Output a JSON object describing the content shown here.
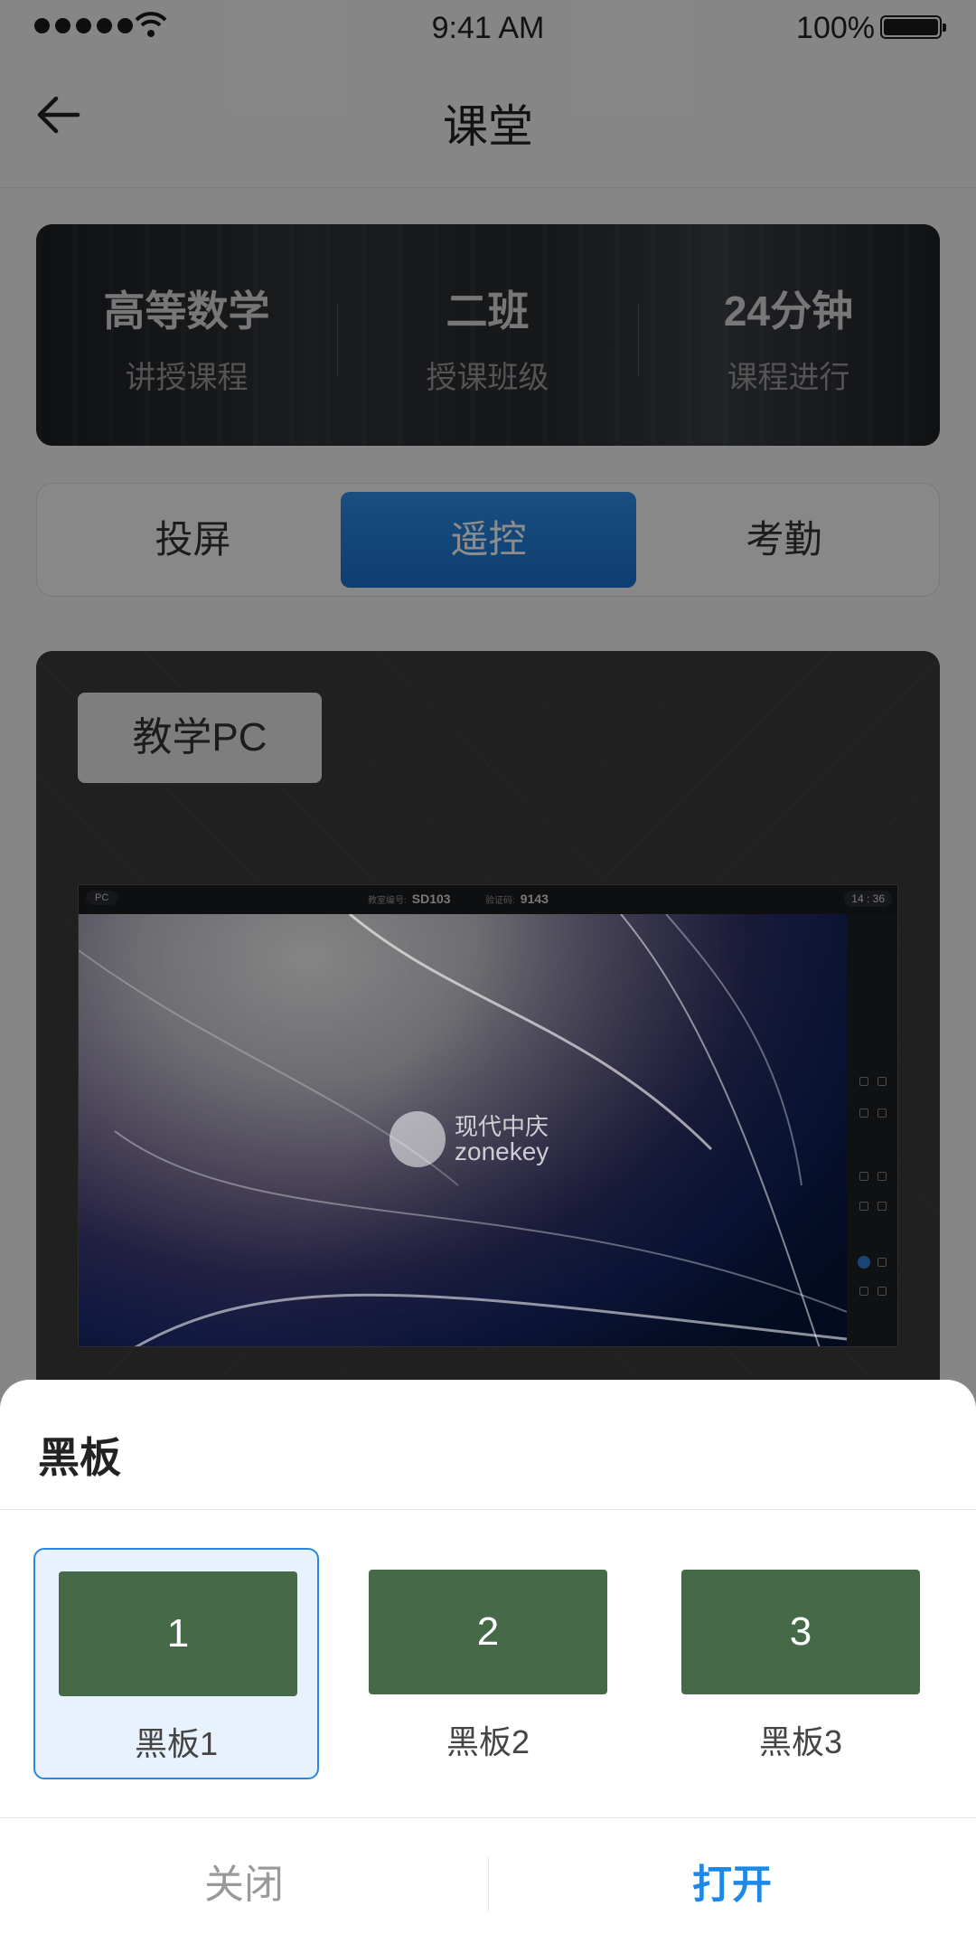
{
  "status_bar": {
    "time": "9:41 AM",
    "battery": "100%"
  },
  "nav": {
    "title": "课堂"
  },
  "banner": {
    "stats": [
      {
        "value": "高等数学",
        "label": "讲授课程"
      },
      {
        "value": "二班",
        "label": "授课班级"
      },
      {
        "value": "24分钟",
        "label": "课程进行"
      }
    ]
  },
  "tabs": [
    {
      "label": "投屏",
      "active": false
    },
    {
      "label": "遥控",
      "active": true
    },
    {
      "label": "考勤",
      "active": false
    }
  ],
  "panel": {
    "source_label": "教学PC",
    "screen": {
      "pc_tag": "PC",
      "room_label": "教室编号:",
      "room_value": "SD103",
      "code_label": "验证码:",
      "code_value": "9143",
      "clock": "14 : 36",
      "logo_cn": "现代中庆",
      "logo_en": "zonekey"
    }
  },
  "sheet": {
    "title": "黑板",
    "boards": [
      {
        "number": "1",
        "label": "黑板1",
        "selected": true
      },
      {
        "number": "2",
        "label": "黑板2",
        "selected": false
      },
      {
        "number": "3",
        "label": "黑板3",
        "selected": false
      }
    ],
    "close_label": "关闭",
    "open_label": "打开"
  },
  "colors": {
    "accent": "#1e88e5",
    "board_green": "#466a48"
  }
}
